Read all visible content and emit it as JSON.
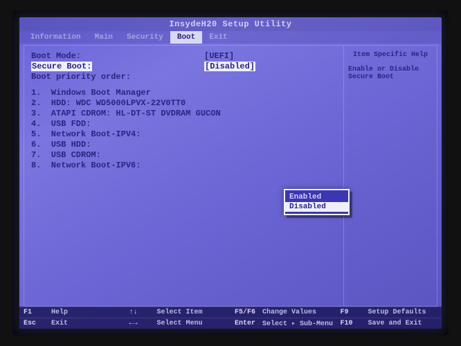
{
  "title": "InsydeH20 Setup Utility",
  "tabs": [
    {
      "label": "Information",
      "active": false
    },
    {
      "label": "Main",
      "active": false
    },
    {
      "label": "Security",
      "active": false
    },
    {
      "label": "Boot",
      "active": true
    },
    {
      "label": "Exit",
      "active": false
    }
  ],
  "settings": {
    "boot_mode": {
      "label": "Boot Mode:",
      "value": "[UEFI]"
    },
    "secure_boot": {
      "label": "Secure Boot:",
      "value": "[Disabled]"
    },
    "priority_label": "Boot priority order:"
  },
  "boot_order": [
    "1.  Windows Boot Manager",
    "2.  HDD: WDC WD5000LPVX-22V0TT0",
    "3.  ATAPI CDROM: HL-DT-ST DVDRAM GUCON",
    "4.  USB FDD:",
    "5.  Network Boot-IPV4:",
    "6.  USB HDD:",
    "7.  USB CDROM:",
    "8.  Network Boot-IPV6:"
  ],
  "popup": {
    "options": [
      "Enabled",
      "Disabled"
    ],
    "selected_index": 1
  },
  "help": {
    "title": "Item Specific Help",
    "body": "Enable or Disable Secure Boot"
  },
  "footer": [
    {
      "key": "F1",
      "action": "Help"
    },
    {
      "key": "↑↓",
      "action": "Select Item"
    },
    {
      "key": "F5/F6",
      "action": "Change Values"
    },
    {
      "key": "F9",
      "action": "Setup Defaults"
    },
    {
      "key": "Esc",
      "action": "Exit"
    },
    {
      "key": "←→",
      "action": "Select Menu"
    },
    {
      "key": "Enter",
      "action": "Select ▸ Sub-Menu"
    },
    {
      "key": "F10",
      "action": "Save and Exit"
    }
  ]
}
